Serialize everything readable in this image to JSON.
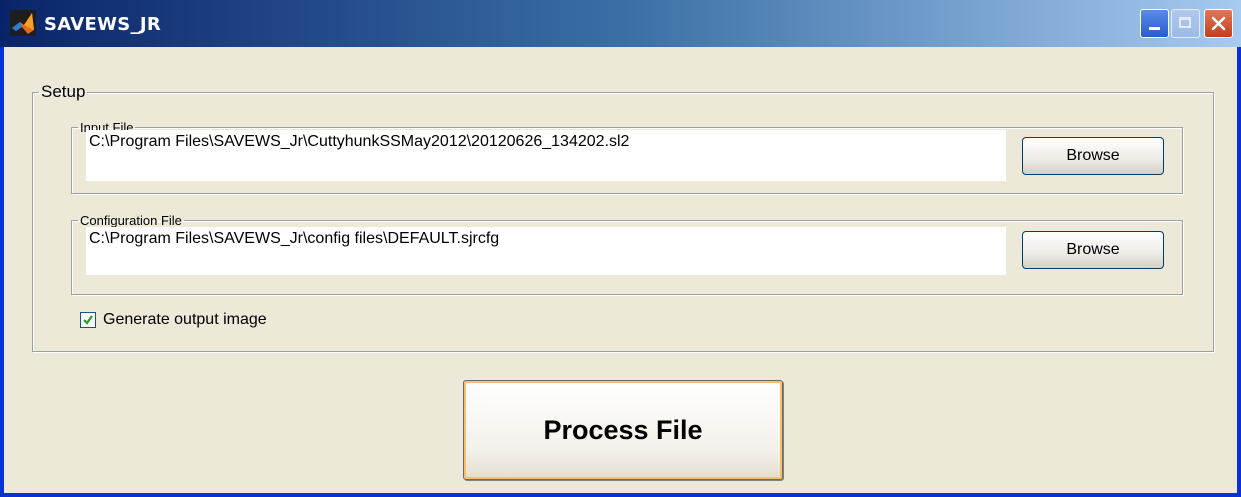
{
  "window": {
    "title": "SAVEWS_JR",
    "icon": "matlab-icon",
    "controls": {
      "minimize": "minimize-icon",
      "maximize": "maximize-icon",
      "close": "close-icon"
    }
  },
  "setup": {
    "legend": "Setup",
    "input_file": {
      "legend": "Input File",
      "path": "C:\\Program Files\\SAVEWS_Jr\\CuttyhunkSSMay2012\\20120626_134202.sl2",
      "browse_label": "Browse"
    },
    "config_file": {
      "legend": "Configuration File",
      "path": "C:\\Program Files\\SAVEWS_Jr\\config files\\DEFAULT.sjrcfg",
      "browse_label": "Browse"
    },
    "generate_output": {
      "label": "Generate output image",
      "checked": true
    }
  },
  "actions": {
    "process_label": "Process File"
  },
  "colors": {
    "titlebar_start": "#0A246A",
    "titlebar_end": "#A6CAF0",
    "window_bg": "#ECE9D8",
    "close_button": "#C1401C"
  }
}
